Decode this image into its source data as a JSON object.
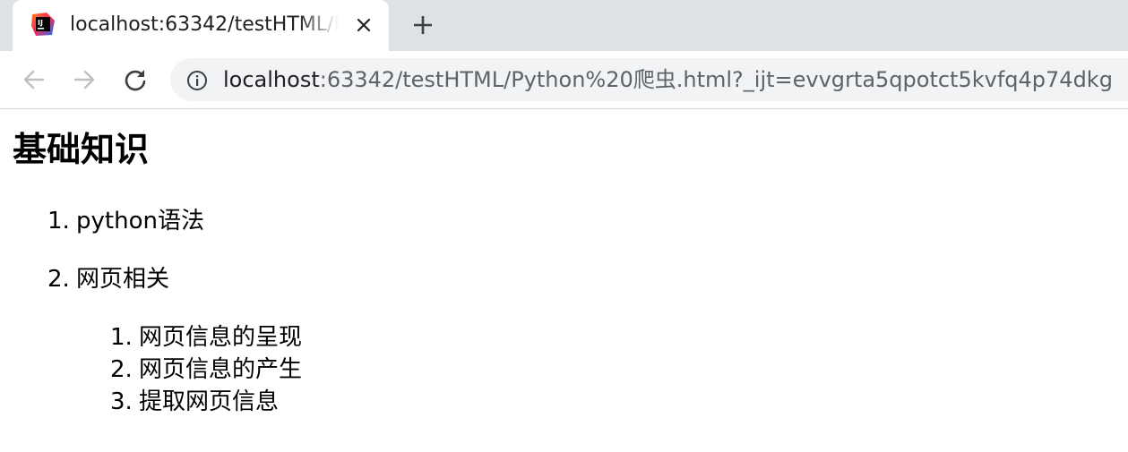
{
  "browser": {
    "tab": {
      "title": "localhost:63342/testHTML/Python%20爬虫.html",
      "favicon": "intellij-idea-icon",
      "close_icon": "close-icon"
    },
    "new_tab_icon": "plus-icon",
    "toolbar": {
      "back_icon": "arrow-left-icon",
      "forward_icon": "arrow-right-icon",
      "reload_icon": "reload-icon",
      "site_info_icon": "info-icon"
    },
    "url": {
      "host": "localhost",
      "rest": ":63342/testHTML/Python%20爬虫.html?_ijt=evvgrta5qpotct5kvfq4p74dkg"
    },
    "colors": {
      "tabstrip_bg": "#dee1e6",
      "omnibox_bg": "#f1f3f4",
      "icon_gray": "#5f6368"
    }
  },
  "page": {
    "heading": "基础知识",
    "list": [
      {
        "num": "1.",
        "label": "python语法"
      },
      {
        "num": "2.",
        "label": "网页相关"
      }
    ],
    "sublist": [
      {
        "num": "1.",
        "label": "网页信息的呈现"
      },
      {
        "num": "2.",
        "label": "网页信息的产生"
      },
      {
        "num": "3.",
        "label": "提取网页信息"
      }
    ]
  }
}
